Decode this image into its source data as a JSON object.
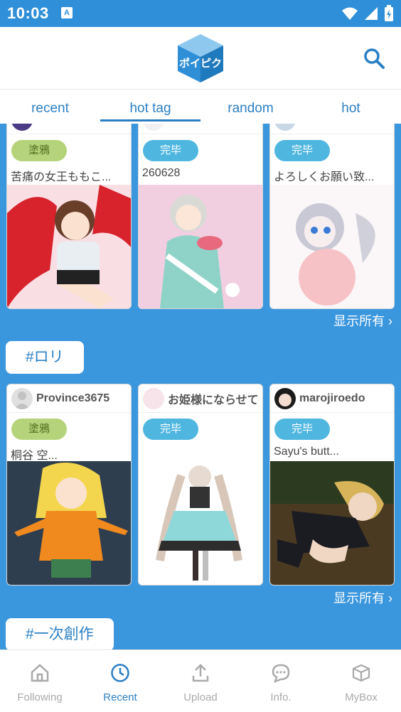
{
  "status": {
    "time": "10:03",
    "a_icon": "A"
  },
  "app": {
    "logo_text": "ポイピク"
  },
  "tabs": [
    {
      "label": "recent"
    },
    {
      "label": "hot tag"
    },
    {
      "label": "random"
    },
    {
      "label": "hot"
    }
  ],
  "section1": {
    "cards": [
      {
        "badge": "塗鴉",
        "title": "苦痛の女王ももこ..."
      },
      {
        "badge": "完毕",
        "title": "260628"
      },
      {
        "badge": "完毕",
        "title": "よろしくお願い致..."
      }
    ],
    "show_all": "显示所有"
  },
  "section2": {
    "tag": "#ロリ",
    "cards": [
      {
        "user": "Province3675",
        "badge": "塗鴉",
        "title": "桐谷 空..."
      },
      {
        "user": "お姫様にならせて",
        "badge": "完毕",
        "title": ""
      },
      {
        "user": "marojiroedo",
        "badge": "完毕",
        "title": "Sayu's butt..."
      }
    ],
    "show_all": "显示所有"
  },
  "section3": {
    "tag": "#一次創作"
  },
  "nav": [
    {
      "label": "Following"
    },
    {
      "label": "Recent"
    },
    {
      "label": "Upload"
    },
    {
      "label": "Info."
    },
    {
      "label": "MyBox"
    }
  ],
  "colors": {
    "primary": "#2a7fc4",
    "background": "#3a96dd",
    "badge_green": "#b5d37a",
    "badge_blue": "#4fb6df"
  }
}
